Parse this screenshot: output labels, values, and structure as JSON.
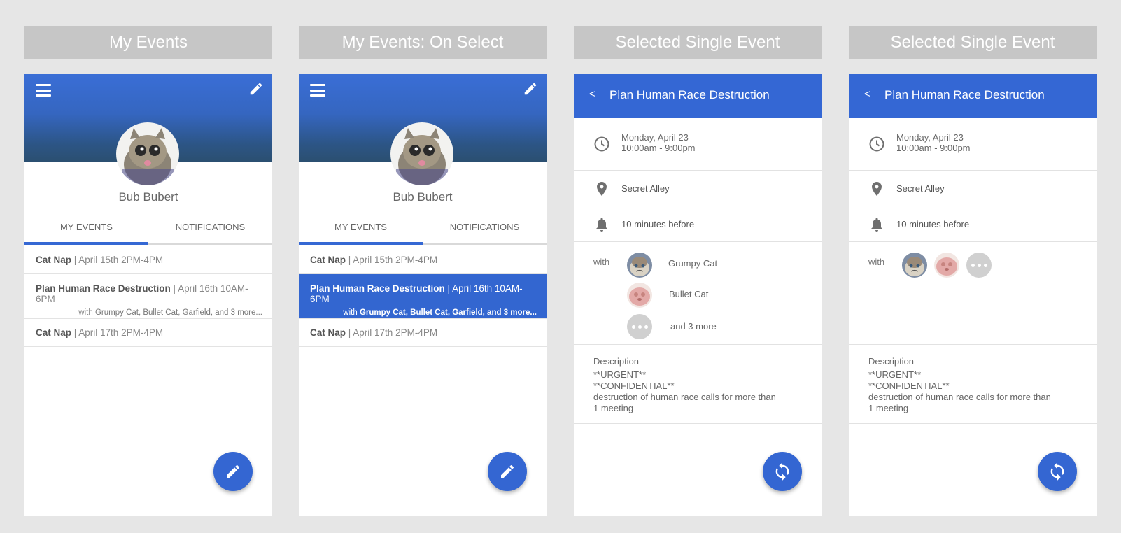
{
  "screens": [
    {
      "title": "My Events"
    },
    {
      "title": "My Events: On Select"
    },
    {
      "title": "Selected Single Event"
    },
    {
      "title": "Selected Single Event"
    }
  ],
  "profile": {
    "name": "Bub Bubert",
    "tabs": [
      "MY EVENTS",
      "NOTIFICATIONS"
    ]
  },
  "events": [
    {
      "title": "Cat Nap",
      "sep": " | ",
      "time": "April 15th 2PM-4PM"
    },
    {
      "title": "Plan Human Race Destruction",
      "sep": " | ",
      "time": "April 16th 10AM-6PM",
      "with_prefix": "with ",
      "with_names": "Grumpy Cat, Bullet Cat, Garfield, and 3 more..."
    },
    {
      "title": "Cat Nap",
      "sep": " | ",
      "time": "April 17th 2PM-4PM"
    }
  ],
  "detail": {
    "back": "<",
    "title": "Plan Human Race Destruction",
    "date": "Monday, April 23",
    "time": "10:00am - 9:00pm",
    "location": "Secret Alley",
    "alarm": "10 minutes before",
    "with_label": "with",
    "people": [
      "Grumpy Cat",
      "Bullet Cat",
      "and 3 more"
    ],
    "description_label": "Description",
    "description": [
      "**URGENT**",
      "**CONFIDENTIAL**",
      "destruction of human race calls for more than",
      "1 meeting"
    ]
  },
  "colors": {
    "primary": "#3467d4",
    "header_gray": "#c6c6c6",
    "background": "#e6e6e6"
  },
  "icons": [
    "menu-icon",
    "edit-icon",
    "clock-icon",
    "location-pin-icon",
    "bell-icon",
    "more-icon",
    "refresh-icon"
  ]
}
